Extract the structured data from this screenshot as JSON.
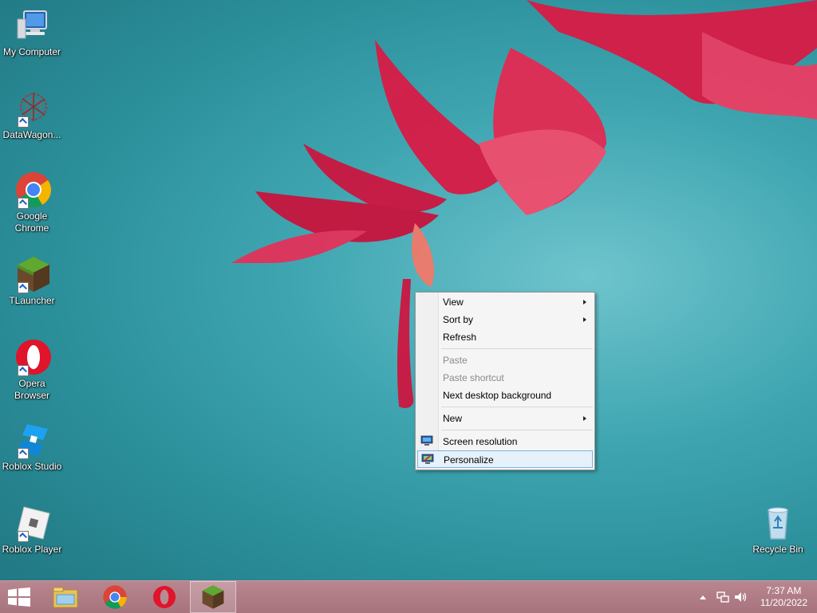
{
  "desktop": {
    "icons": [
      {
        "label": "My Computer",
        "icon": "computer-icon",
        "shortcut": false
      },
      {
        "label": "DataWagon...",
        "icon": "datawagon-icon",
        "shortcut": true
      },
      {
        "label": "Google Chrome",
        "icon": "chrome-icon",
        "shortcut": true
      },
      {
        "label": "TLauncher",
        "icon": "tlauncher-icon",
        "shortcut": true
      },
      {
        "label": "Opera Browser",
        "icon": "opera-icon",
        "shortcut": true
      },
      {
        "label": "Roblox Studio",
        "icon": "roblox-studio-icon",
        "shortcut": true
      },
      {
        "label": "Roblox Player",
        "icon": "roblox-player-icon",
        "shortcut": true
      }
    ],
    "recycle_bin": {
      "label": "Recycle Bin",
      "icon": "recycle-bin-icon"
    }
  },
  "context_menu": {
    "items": [
      {
        "label": "View",
        "submenu": true,
        "disabled": false
      },
      {
        "label": "Sort by",
        "submenu": true,
        "disabled": false
      },
      {
        "label": "Refresh",
        "submenu": false,
        "disabled": false
      },
      {
        "label": "Paste",
        "submenu": false,
        "disabled": true
      },
      {
        "label": "Paste shortcut",
        "submenu": false,
        "disabled": true
      },
      {
        "label": "Next desktop background",
        "submenu": false,
        "disabled": false
      },
      {
        "label": "New",
        "submenu": true,
        "disabled": false
      },
      {
        "label": "Screen resolution",
        "submenu": false,
        "disabled": false,
        "icon": "display-icon"
      },
      {
        "label": "Personalize",
        "submenu": false,
        "disabled": false,
        "icon": "personalize-icon",
        "highlighted": true
      }
    ]
  },
  "taskbar": {
    "start": "start-icon",
    "pinned": [
      "file-explorer-icon",
      "chrome-icon",
      "opera-icon",
      "tlauncher-icon"
    ],
    "active": "tlauncher-icon",
    "tray": [
      "show-hidden-icons-icon",
      "network-icon",
      "volume-icon"
    ],
    "clock_time": "7:37 AM",
    "clock_date": "11/20/2022"
  },
  "colors": {
    "wallpaper_teal": "#3fa6b1",
    "flower_red": "#d11a3e",
    "taskbar": "#b07c86",
    "menu_highlight": "#e5f1fb"
  }
}
